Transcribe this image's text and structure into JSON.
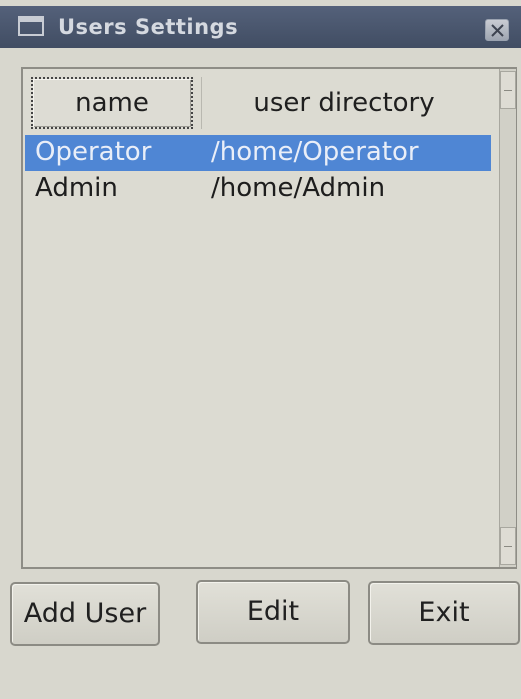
{
  "window": {
    "title": "Users Settings"
  },
  "list": {
    "columns": [
      "name",
      "user directory"
    ],
    "rows": [
      {
        "name": "Operator",
        "directory": "/home/Operator",
        "selected": true
      },
      {
        "name": "Admin",
        "directory": "/home/Admin",
        "selected": false
      }
    ]
  },
  "buttons": {
    "add_user": "Add User",
    "edit": "Edit",
    "exit": "Exit"
  },
  "icons": {
    "window": "window-icon",
    "close": "close-icon",
    "scroll_up": "scroll-up-icon",
    "scroll_down": "scroll-down-icon"
  },
  "colors": {
    "titlebar": "#4a566d",
    "selection": "#4f86d4",
    "background": "#d8d7ce"
  }
}
